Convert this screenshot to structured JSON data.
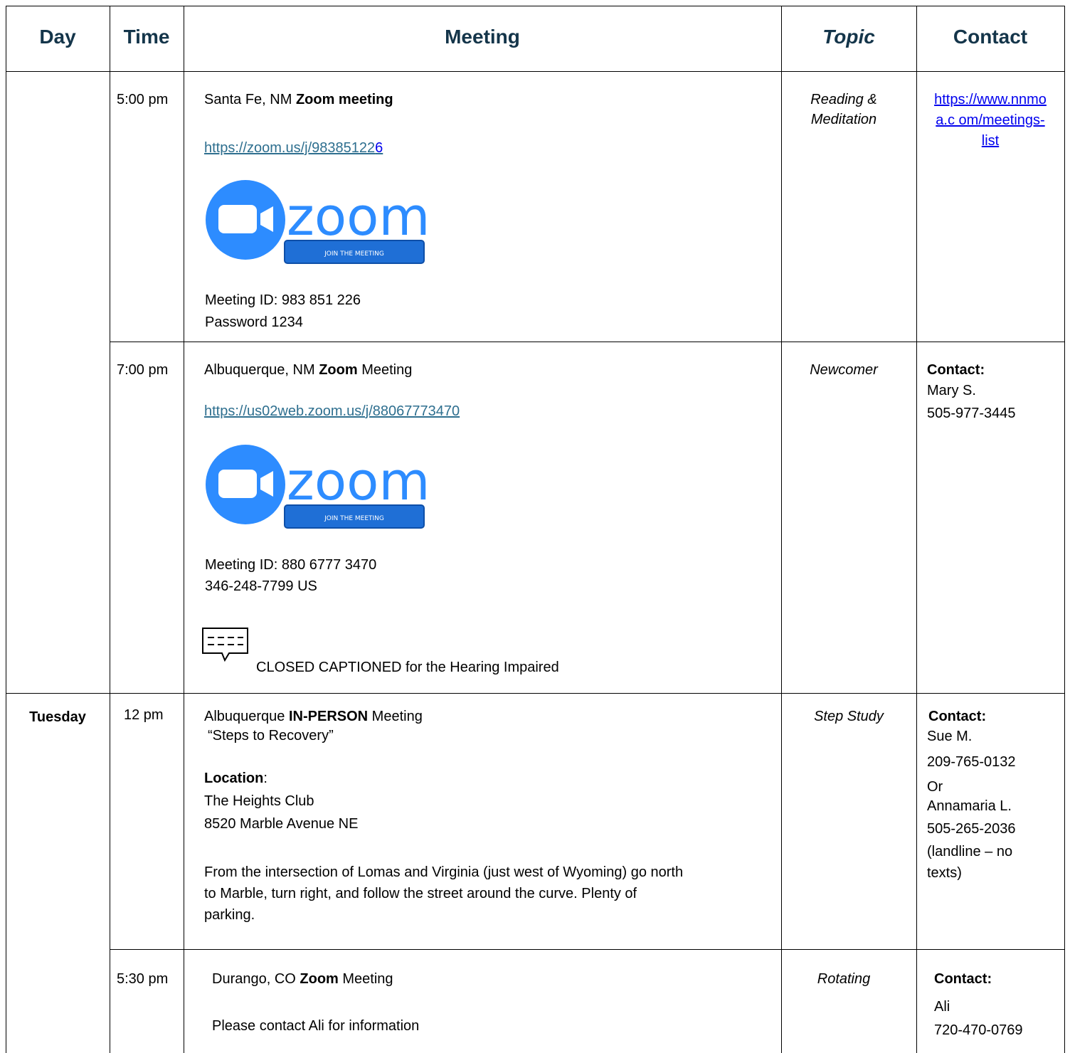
{
  "header": {
    "day": "Day",
    "time": "Time",
    "meeting": "Meeting",
    "topic": "Topic",
    "contact": "Contact"
  },
  "rows": [
    {
      "day": "",
      "time": "5:00 pm",
      "meeting": {
        "title_prefix": "Santa Fe, NM ",
        "title_bold": "Zoom meeting",
        "link_main": "https://zoom.us/j/98385122",
        "link_tail": "6",
        "logo_button": "JOIN THE MEETING",
        "logo_text": "zoom",
        "line1": "Meeting ID: 983 851 226",
        "line2": "Password 1234"
      },
      "topic": [
        "Reading &",
        "Meditation"
      ],
      "contact_link": [
        "https://www.nnmo",
        "a.c om/meetings-",
        "list"
      ]
    },
    {
      "day": "",
      "time": "7:00 pm",
      "meeting": {
        "title_prefix": "Albuquerque, NM ",
        "title_bold": "Zoom",
        "title_suffix": " Meeting",
        "link": "https://us02web.zoom.us/j/88067773470",
        "logo_button": "JOIN THE MEETING",
        "logo_text": "zoom",
        "line1": "Meeting ID: 880 6777 3470",
        "line2": "346-248-7799 US",
        "caption_note": "CLOSED CAPTIONED for the Hearing Impaired"
      },
      "topic": [
        "Newcomer"
      ],
      "contact": {
        "label": "Contact:",
        "lines": [
          "Mary S.",
          "505-977-3445"
        ]
      }
    },
    {
      "day": "Tuesday",
      "time": "12 pm",
      "meeting": {
        "title_prefix": "Albuquerque ",
        "title_bold": "IN-PERSON",
        "title_suffix": " Meeting",
        "subtitle": "“Steps to Recovery”",
        "location_label": "Location",
        "location_colon": ":",
        "place": "The Heights Club",
        "address": "8520 Marble Avenue NE",
        "directions": [
          "From the intersection of Lomas and Virginia (just west of Wyoming) go north",
          "to Marble, turn right, and follow the street around the curve. Plenty of",
          "parking."
        ]
      },
      "topic": [
        "Step Study"
      ],
      "contact": {
        "label": "Contact:",
        "lines": [
          "Sue M.",
          "209-765-0132",
          "Or",
          "Annamaria L.",
          "505-265-2036",
          "(landline – no",
          "texts)"
        ]
      }
    },
    {
      "day": "",
      "time": "5:30 pm",
      "meeting": {
        "title_prefix": "Durango, CO ",
        "title_bold": "Zoom",
        "title_suffix": " Meeting",
        "line1": "Please contact Ali for information"
      },
      "topic": [
        "Rotating"
      ],
      "contact": {
        "label": "Contact:",
        "lines": [
          "Ali",
          "720-470-0769"
        ]
      }
    }
  ],
  "colors": {
    "header_text": "#14354a",
    "zoom_blue": "#2d8cff",
    "link_blue": "#0000ee",
    "zoom_link": "#2e6f8f"
  },
  "icons": [
    "zoom-logo-icon",
    "closed-caption-icon"
  ]
}
